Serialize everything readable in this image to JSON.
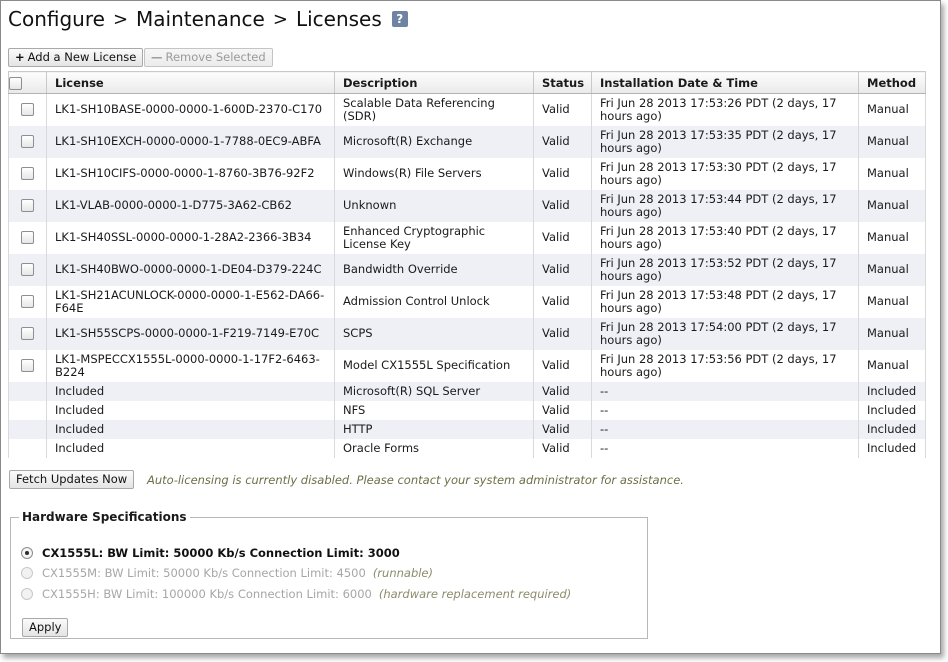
{
  "breadcrumb": {
    "items": [
      "Configure",
      "Maintenance",
      "Licenses"
    ],
    "separator": ">",
    "help_label": "?"
  },
  "toolbar": {
    "add_label": "Add a New License",
    "add_glyph": "+",
    "remove_label": "Remove Selected",
    "remove_glyph": "—"
  },
  "table": {
    "headers": {
      "license": "License",
      "description": "Description",
      "status": "Status",
      "installed": "Installation Date & Time",
      "method": "Method"
    },
    "rows": [
      {
        "license": "LK1-SH10BASE-0000-0000-1-600D-2370-C170",
        "description": "Scalable Data Referencing (SDR)",
        "status": "Valid",
        "installed": "Fri Jun 28 2013 17:53:26 PDT (2 days, 17 hours ago)",
        "method": "Manual"
      },
      {
        "license": "LK1-SH10EXCH-0000-0000-1-7788-0EC9-ABFA",
        "description": "Microsoft(R) Exchange",
        "status": "Valid",
        "installed": "Fri Jun 28 2013 17:53:35 PDT (2 days, 17 hours ago)",
        "method": "Manual"
      },
      {
        "license": "LK1-SH10CIFS-0000-0000-1-8760-3B76-92F2",
        "description": "Windows(R) File Servers",
        "status": "Valid",
        "installed": "Fri Jun 28 2013 17:53:30 PDT (2 days, 17 hours ago)",
        "method": "Manual"
      },
      {
        "license": "LK1-VLAB-0000-0000-1-D775-3A62-CB62",
        "description": "Unknown",
        "status": "Valid",
        "installed": "Fri Jun 28 2013 17:53:44 PDT (2 days, 17 hours ago)",
        "method": "Manual"
      },
      {
        "license": "LK1-SH40SSL-0000-0000-1-28A2-2366-3B34",
        "description": "Enhanced Cryptographic License Key",
        "status": "Valid",
        "installed": "Fri Jun 28 2013 17:53:40 PDT (2 days, 17 hours ago)",
        "method": "Manual"
      },
      {
        "license": "LK1-SH40BWO-0000-0000-1-DE04-D379-224C",
        "description": "Bandwidth Override",
        "status": "Valid",
        "installed": "Fri Jun 28 2013 17:53:52 PDT (2 days, 17 hours ago)",
        "method": "Manual"
      },
      {
        "license": "LK1-SH21ACUNLOCK-0000-0000-1-E562-DA66-F64E",
        "description": "Admission Control Unlock",
        "status": "Valid",
        "installed": "Fri Jun 28 2013 17:53:48 PDT (2 days, 17 hours ago)",
        "method": "Manual"
      },
      {
        "license": "LK1-SH55SCPS-0000-0000-1-F219-7149-E70C",
        "description": "SCPS",
        "status": "Valid",
        "installed": "Fri Jun 28 2013 17:54:00 PDT (2 days, 17 hours ago)",
        "method": "Manual"
      },
      {
        "license": "LK1-MSPECCX1555L-0000-0000-1-17F2-6463-B224",
        "description": "Model CX1555L Specification",
        "status": "Valid",
        "installed": "Fri Jun 28 2013 17:53:56 PDT (2 days, 17 hours ago)",
        "method": "Manual"
      }
    ],
    "included_rows": [
      {
        "license": "Included",
        "description": "Microsoft(R) SQL Server",
        "status": "Valid",
        "installed": "--",
        "method": "Included"
      },
      {
        "license": "Included",
        "description": "NFS",
        "status": "Valid",
        "installed": "--",
        "method": "Included"
      },
      {
        "license": "Included",
        "description": "HTTP",
        "status": "Valid",
        "installed": "--",
        "method": "Included"
      },
      {
        "license": "Included",
        "description": "Oracle Forms",
        "status": "Valid",
        "installed": "--",
        "method": "Included"
      }
    ]
  },
  "autolicensing": {
    "fetch_label": "Fetch Updates Now",
    "message": "Auto-licensing is currently disabled. Please contact your system administrator for assistance."
  },
  "hardware": {
    "legend": "Hardware Specifications",
    "options": [
      {
        "label": "CX1555L: BW Limit: 50000 Kb/s Connection Limit: 3000",
        "note": "",
        "selected": true,
        "enabled": true
      },
      {
        "label": "CX1555M: BW Limit: 50000 Kb/s Connection Limit: 4500",
        "note": "(runnable)",
        "selected": false,
        "enabled": false
      },
      {
        "label": "CX1555H: BW Limit: 100000 Kb/s Connection Limit: 6000",
        "note": "(hardware replacement required)",
        "selected": false,
        "enabled": false
      }
    ],
    "apply_label": "Apply"
  }
}
